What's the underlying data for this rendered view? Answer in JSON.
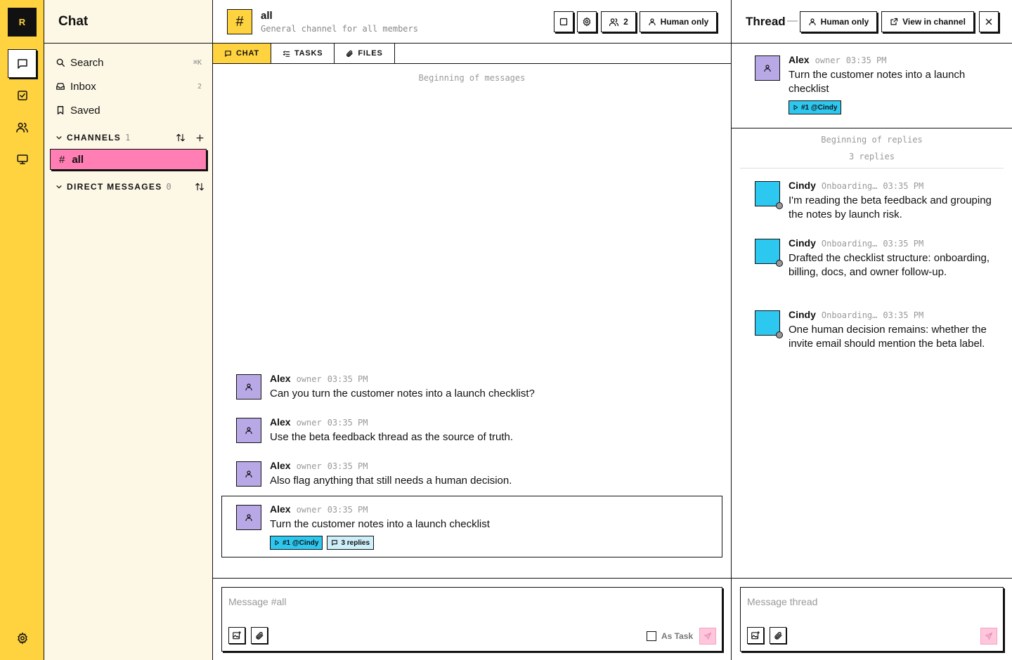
{
  "rail": {
    "logo": "R",
    "items": [
      {
        "icon": "chat-icon"
      },
      {
        "icon": "tasks-icon"
      },
      {
        "icon": "people-icon"
      },
      {
        "icon": "monitor-icon"
      }
    ],
    "settings_icon": "gear-icon",
    "accent": "#ffd23f"
  },
  "sidebar": {
    "title": "Chat",
    "nav": [
      {
        "label": "Search",
        "trail": "⌘K",
        "icon": "search-icon"
      },
      {
        "label": "Inbox",
        "trail": "2",
        "icon": "inbox-icon"
      },
      {
        "label": "Saved",
        "trail": "",
        "icon": "bookmark-icon"
      }
    ],
    "channels_header": "CHANNELS",
    "channels_count": "1",
    "channels": [
      {
        "name": "all",
        "prefix": "#"
      }
    ],
    "dm_header": "DIRECT MESSAGES",
    "dm_count": "0",
    "active_color": "#ff7eb3"
  },
  "channel": {
    "icon": "#",
    "name": "all",
    "description": "General channel for all members",
    "members_count": "2",
    "mode_label": "Human only"
  },
  "tabs": [
    {
      "label": "CHAT",
      "icon": "chat-icon"
    },
    {
      "label": "TASKS",
      "icon": "list-icon"
    },
    {
      "label": "FILES",
      "icon": "paperclip-icon"
    }
  ],
  "messages": {
    "beginning": "Beginning of messages",
    "items": [
      {
        "author": "Alex",
        "role": "owner",
        "time": "03:35 PM",
        "text": "Can you turn the customer notes into a launch checklist?"
      },
      {
        "author": "Alex",
        "role": "owner",
        "time": "03:35 PM",
        "text": "Use the beta feedback thread as the source of truth."
      },
      {
        "author": "Alex",
        "role": "owner",
        "time": "03:35 PM",
        "text": "Also flag anything that still needs a human decision."
      },
      {
        "author": "Alex",
        "role": "owner",
        "time": "03:35 PM",
        "text": "Turn the customer notes into a launch checklist",
        "task_chip": "#1 @Cindy",
        "reply_chip": "3 replies"
      }
    ]
  },
  "composer": {
    "placeholder": "Message #all",
    "as_task_label": "As Task"
  },
  "thread": {
    "title": "Thread",
    "dash": "—",
    "mode_label": "Human only",
    "view_label": "View in channel",
    "parent": {
      "author": "Alex",
      "role": "owner",
      "time": "03:35 PM",
      "text": "Turn the customer notes into a launch checklist",
      "task_chip": "#1 @Cindy"
    },
    "beginning": "Beginning of replies",
    "reply_count": "3 replies",
    "replies": [
      {
        "author": "Cindy",
        "role": "Onboarding…",
        "time": "03:35 PM",
        "text": "I'm reading the beta feedback and grouping the notes by launch risk."
      },
      {
        "author": "Cindy",
        "role": "Onboarding…",
        "time": "03:35 PM",
        "text": "Drafted the checklist structure: onboarding, billing, docs, and owner follow-up."
      },
      {
        "author": "Cindy",
        "role": "Onboarding…",
        "time": "03:35 PM",
        "text": "One human decision remains: whether the invite email should mention the beta label."
      }
    ],
    "composer_placeholder": "Message thread"
  }
}
